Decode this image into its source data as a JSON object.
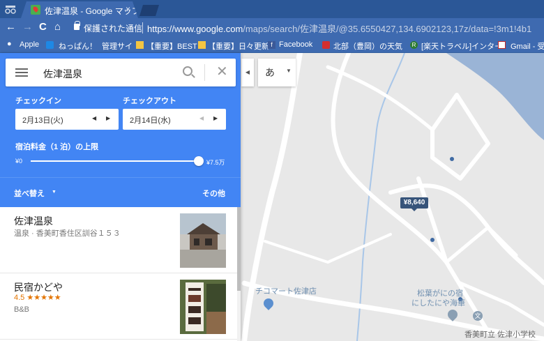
{
  "browser": {
    "tab_title": "佐津温泉 - Google マップ",
    "tab_close": "×",
    "secure_label": "保護された通信",
    "url_host": "https://www.google.com",
    "url_path": "/maps/search/佐津温泉/@35.6550427,134.6902123,17z/data=!3m1!4b1",
    "nav": {
      "back": "←",
      "forward": "→",
      "reload": "C",
      "home": "⌂"
    }
  },
  "bookmarks": [
    {
      "label": "Apple"
    },
    {
      "label": "ねっぱん！"
    },
    {
      "label": "管理サイ"
    },
    {
      "label": "【重要】BEST"
    },
    {
      "label": "【重要】日々更新"
    },
    {
      "label": "Facebook"
    },
    {
      "label": "北部（豊岡）の天気"
    },
    {
      "label": "[楽天トラベル]インター"
    },
    {
      "label": "Gmail - 受"
    }
  ],
  "search": {
    "query": "佐津温泉"
  },
  "filters": {
    "checkin_label": "チェックイン",
    "checkout_label": "チェックアウト",
    "checkin_date": "2月13日(火)",
    "checkout_date": "2月14日(水)",
    "price_label": "宿泊料金（1 泊）の上限",
    "price_min": "¥0",
    "price_max": "¥7.5万",
    "price_level": 1.0,
    "sort_label": "並べ替え",
    "other_label": "その他"
  },
  "results": [
    {
      "name": "佐津温泉",
      "subtitle": "温泉 · 香美町香住区訓谷１５３",
      "rating": "",
      "type": ""
    },
    {
      "name": "民宿かどや",
      "subtitle": "",
      "rating": "4.5 ★★★★★",
      "type": "B&B"
    }
  ],
  "map": {
    "lang_char": "あ",
    "price_pin": "¥8,640",
    "labels": {
      "store": "チコマート佐津店",
      "inn_line1": "松葉がにの宿",
      "inn_line2": "にしたにや海華",
      "school": "香美町立 佐津小学校",
      "school_icon": "文"
    },
    "colors": {
      "panel_blue": "#4285f4",
      "tab_blue": "#2b5797",
      "pin": "#37547a",
      "poi_blue": "#5b8fcf",
      "poi_grey": "#8a9fb3"
    }
  }
}
